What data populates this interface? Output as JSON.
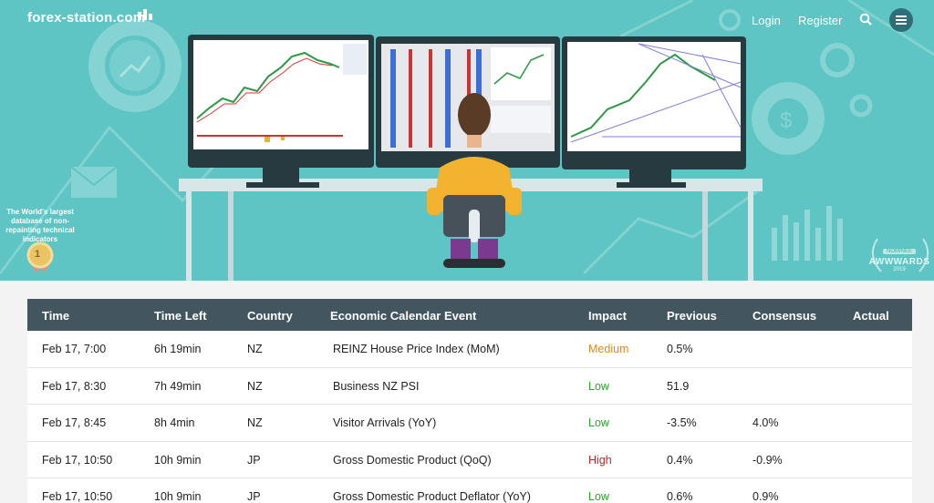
{
  "brand": {
    "name": "forex-station.com"
  },
  "nav": {
    "login": "Login",
    "register": "Register"
  },
  "hero": {
    "badge_text": "The World's largest database of non-repainting technical indicators",
    "award_label": "NOMINEE",
    "award_name": "AWWWARDS",
    "award_year": "2019",
    "rank_number": "1"
  },
  "colors": {
    "hero_bg": "#5ec5c4",
    "header_bg": "#435660",
    "medium": "#d98a1c",
    "low": "#2aa52a",
    "high": "#c0262b"
  },
  "table": {
    "headers": [
      "Time",
      "Time Left",
      "Country",
      "Economic Calendar Event",
      "Impact",
      "Previous",
      "Consensus",
      "Actual"
    ],
    "rows": [
      {
        "time": "Feb 17, 7:00",
        "left": "6h 19min",
        "country": "NZ",
        "event": "REINZ House Price Index (MoM)",
        "impact": "Medium",
        "previous": "0.5%",
        "consensus": "",
        "actual": ""
      },
      {
        "time": "Feb 17, 8:30",
        "left": "7h 49min",
        "country": "NZ",
        "event": "Business NZ PSI",
        "impact": "Low",
        "previous": "51.9",
        "consensus": "",
        "actual": ""
      },
      {
        "time": "Feb 17, 8:45",
        "left": "8h 4min",
        "country": "NZ",
        "event": "Visitor Arrivals (YoY)",
        "impact": "Low",
        "previous": "-3.5%",
        "consensus": "4.0%",
        "actual": ""
      },
      {
        "time": "Feb 17, 10:50",
        "left": "10h 9min",
        "country": "JP",
        "event": "Gross Domestic Product (QoQ)",
        "impact": "High",
        "previous": "0.4%",
        "consensus": "-0.9%",
        "actual": ""
      },
      {
        "time": "Feb 17, 10:50",
        "left": "10h 9min",
        "country": "JP",
        "event": "Gross Domestic Product Deflator (YoY)",
        "impact": "Low",
        "previous": "0.6%",
        "consensus": "0.9%",
        "actual": ""
      }
    ]
  }
}
